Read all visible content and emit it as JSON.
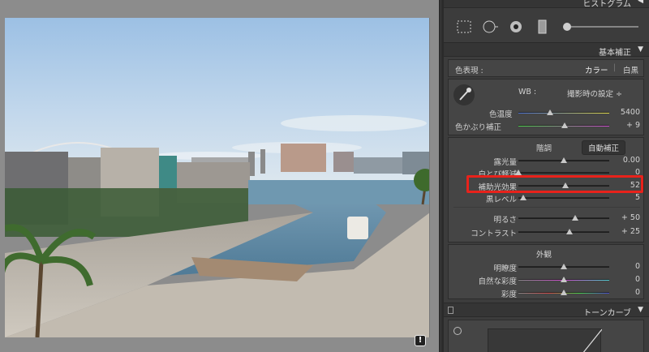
{
  "histogram_header": {
    "title": "ヒストグラム"
  },
  "basic": {
    "header": "基本補正",
    "color_label": "色表現 :",
    "color_option": "カラー",
    "bw_option": "白黒",
    "wb_label": "WB :",
    "wb_value": "撮影時の設定 ÷",
    "temp_label": "色温度",
    "temp_value": "5400",
    "tint_label": "色かぶり補正",
    "tint_value": "+ 9",
    "tone_label": "階調",
    "auto_label": "自動補正",
    "sliders": [
      {
        "label": "露光量",
        "value": "0.00",
        "pos": 0.5
      },
      {
        "label": "白とび軽減",
        "value": "0",
        "pos": 0.0
      },
      {
        "label": "補助光効果",
        "value": "52",
        "pos": 0.52
      },
      {
        "label": "黒レベル",
        "value": "5",
        "pos": 0.05
      },
      {
        "label": "明るさ",
        "value": "+ 50",
        "pos": 0.625
      },
      {
        "label": "コントラスト",
        "value": "+ 25",
        "pos": 0.5625
      }
    ],
    "presence_label": "外観",
    "presence": [
      {
        "label": "明瞭度",
        "value": "0",
        "pos": 0.5
      },
      {
        "label": "自然な彩度",
        "value": "0",
        "pos": 0.5
      },
      {
        "label": "彩度",
        "value": "0",
        "pos": 0.5
      }
    ]
  },
  "tone_curve": {
    "header": "トーンカーブ"
  },
  "colors": {
    "accent_highlight": "#e8221b",
    "temp_gradient": [
      "#4a6fd0",
      "#e0d84a"
    ],
    "tint_gradient": [
      "#4ad04a",
      "#d04ad0"
    ],
    "panel_bg": "#3c3c3c"
  },
  "photo": {
    "info_badge": "!"
  }
}
